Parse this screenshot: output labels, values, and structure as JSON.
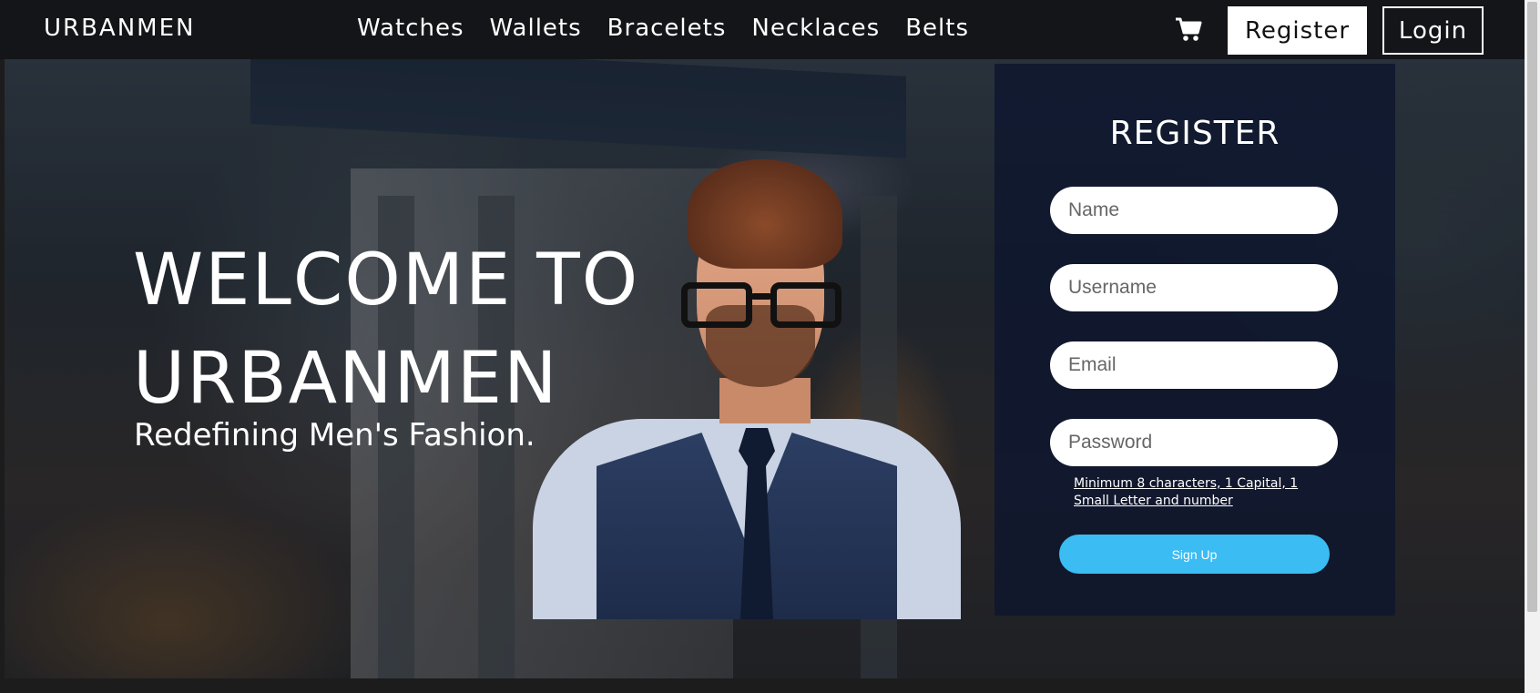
{
  "navbar": {
    "brand": "URBANMEN",
    "links": [
      "Watches",
      "Wallets",
      "Bracelets",
      "Necklaces",
      "Belts"
    ],
    "cart_icon": "shopping-cart-icon",
    "register_label": "Register",
    "login_label": "Login"
  },
  "hero": {
    "title_line1": "WELCOME TO",
    "title_line2": "URBANMEN",
    "subtitle": "Redefining Men's Fashion."
  },
  "register_form": {
    "heading": "REGISTER",
    "name_placeholder": "Name",
    "username_placeholder": "Username",
    "email_placeholder": "Email",
    "password_placeholder": "Password",
    "password_hint": "Minimum 8 characters, 1 Capital, 1 Small Letter and number",
    "submit_label": "Sign Up"
  },
  "colors": {
    "accent": "#3bbcf3",
    "panel": "#0e162e",
    "navbar": "#121418"
  }
}
